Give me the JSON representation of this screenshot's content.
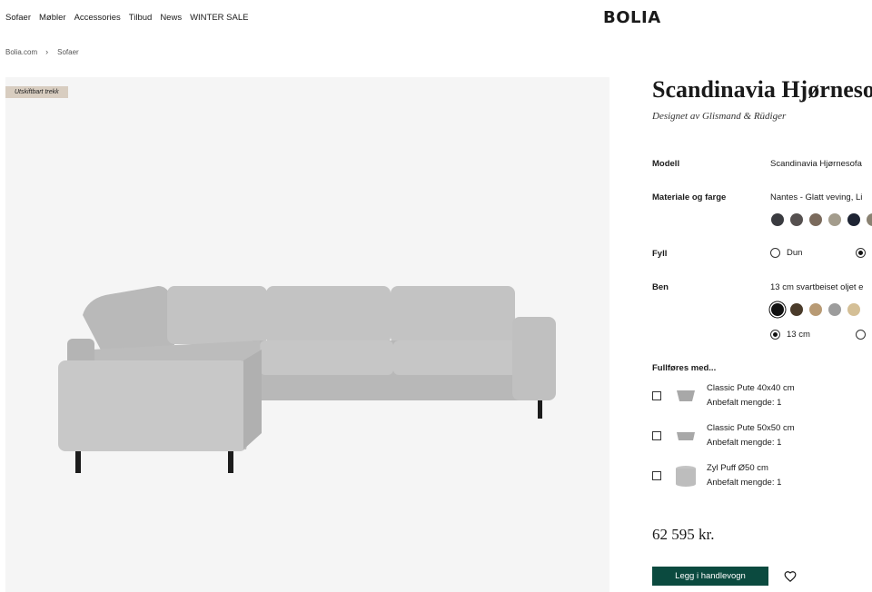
{
  "nav": {
    "items": [
      {
        "label": "Sofaer"
      },
      {
        "label": "Møbler"
      },
      {
        "label": "Accessories"
      },
      {
        "label": "Tilbud"
      },
      {
        "label": "News"
      },
      {
        "label": "WINTER SALE"
      }
    ],
    "logo": "BOLIA"
  },
  "breadcrumb": {
    "home": "Bolia.com",
    "current": "Sofaer"
  },
  "gallery": {
    "badge": "Utskiftbart trekk"
  },
  "product": {
    "title": "Scandinavia Hjørnesofa",
    "designer": "Designet av Glismand & Rüdiger",
    "model_label": "Modell",
    "model_value": "Scandinavia Hjørnesofa",
    "material_label": "Materiale og farge",
    "material_value": "Nantes - Glatt veving, Li",
    "material_swatches": [
      "#3a3b40",
      "#55504f",
      "#7a6a5c",
      "#a39c8c",
      "#1e2433",
      "#8a8272"
    ],
    "fill_label": "Fyll",
    "fill_option_1": "Dun",
    "legs_label": "Ben",
    "legs_value": "13 cm svartbeiset oljet e",
    "legs_swatches": [
      "#111111",
      "#4a3b2a",
      "#b89a74",
      "#9c9c9c",
      "#d4bf96"
    ],
    "legs_height_1": "13 cm"
  },
  "complete_with": {
    "title": "Fullføres med...",
    "items": [
      {
        "name": "Classic Pute 40x40 cm",
        "qty": "Anbefalt mengde: 1"
      },
      {
        "name": "Classic Pute 50x50 cm",
        "qty": "Anbefalt mengde: 1"
      },
      {
        "name": "Zyl Puff Ø50 cm",
        "qty": "Anbefalt mengde: 1"
      }
    ]
  },
  "purchase": {
    "price": "62 595 kr.",
    "cart_label": "Legg i handlevogn"
  },
  "colors": {
    "accent": "#0b4a3f",
    "badge_bg": "#d8cdc0",
    "gallery_bg": "#f5f5f5"
  }
}
